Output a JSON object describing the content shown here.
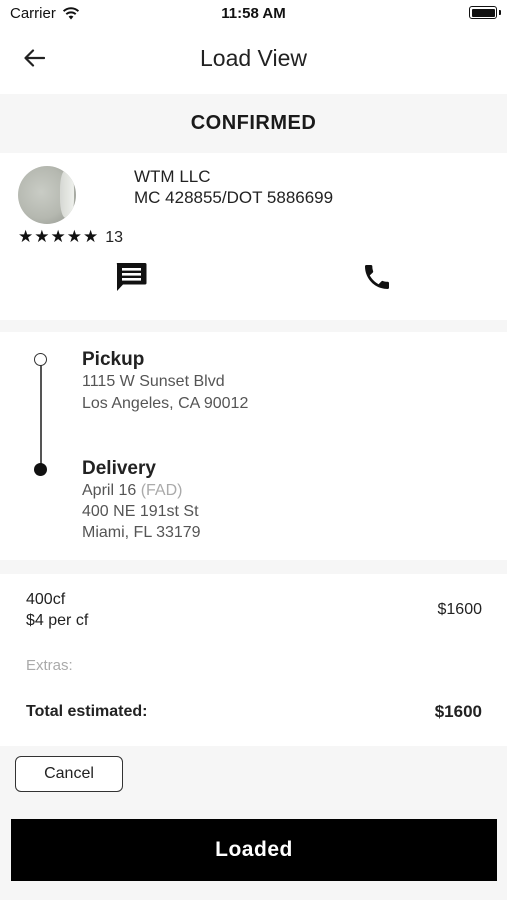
{
  "status_bar": {
    "carrier": "Carrier",
    "time": "11:58 AM",
    "wifi_icon": "wifi-icon",
    "battery_icon": "battery-icon"
  },
  "nav": {
    "title": "Load View",
    "back_icon": "arrow-left-icon"
  },
  "load_status": "CONFIRMED",
  "carrier_info": {
    "company_name": "WTM LLC",
    "ids": "MC 428855/DOT 5886699",
    "stars": "★★★★★",
    "rating_count": "13",
    "message_icon": "message-icon",
    "phone_icon": "phone-icon"
  },
  "route": {
    "pickup": {
      "title": "Pickup",
      "address_line1": "1115 W Sunset Blvd",
      "address_line2": "Los Angeles, CA 90012"
    },
    "delivery": {
      "title": "Delivery",
      "date": "April 16",
      "date_tag": "(FAD)",
      "address_line1": "400 NE 191st St",
      "address_line2": "Miami, FL 33179"
    }
  },
  "pricing": {
    "volume": "400cf",
    "rate": "$4 per cf",
    "line_price": "$1600",
    "extras_label": "Extras:",
    "total_label": "Total estimated:",
    "total_value": "$1600"
  },
  "actions": {
    "cancel_label": "Cancel",
    "loaded_label": "Loaded"
  },
  "colors": {
    "primary_button_bg": "#000000",
    "section_bg": "#f6f6f6",
    "muted_text": "#aaaaaa"
  }
}
